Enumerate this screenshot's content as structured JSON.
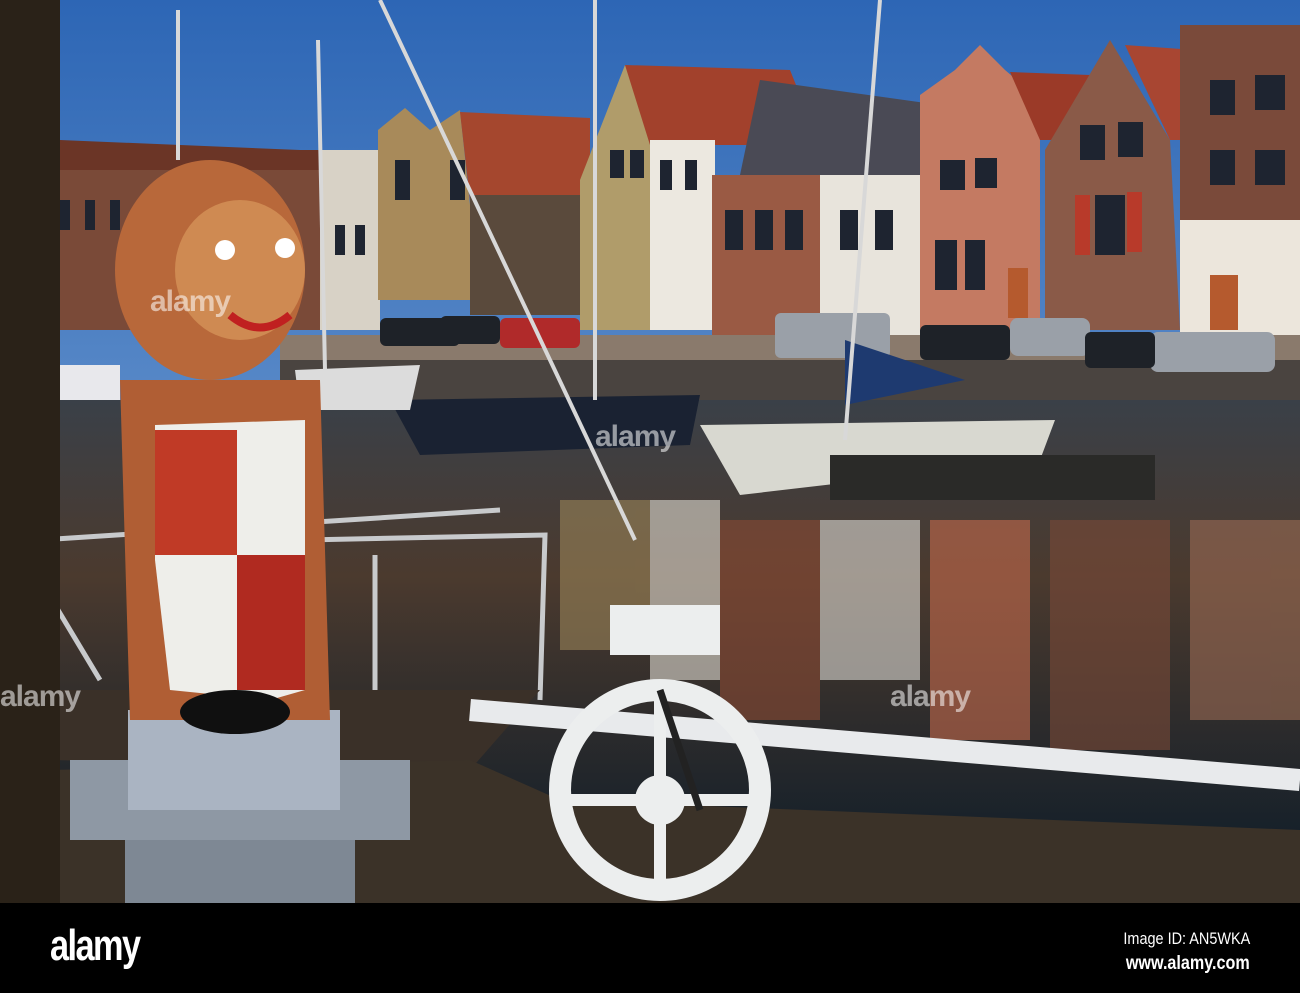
{
  "photo": {
    "subject": "Harbour scene with lion statue holding a coat of arms",
    "watermark_text": "alamy"
  },
  "footer": {
    "logo": "alamy",
    "image_id": "Image ID: AN5WKA",
    "url": "www.alamy.com"
  },
  "colors": {
    "sky": "#3a72b8",
    "water": "#1c2630",
    "lion": "#b8683a",
    "footer_bg": "#000000"
  }
}
